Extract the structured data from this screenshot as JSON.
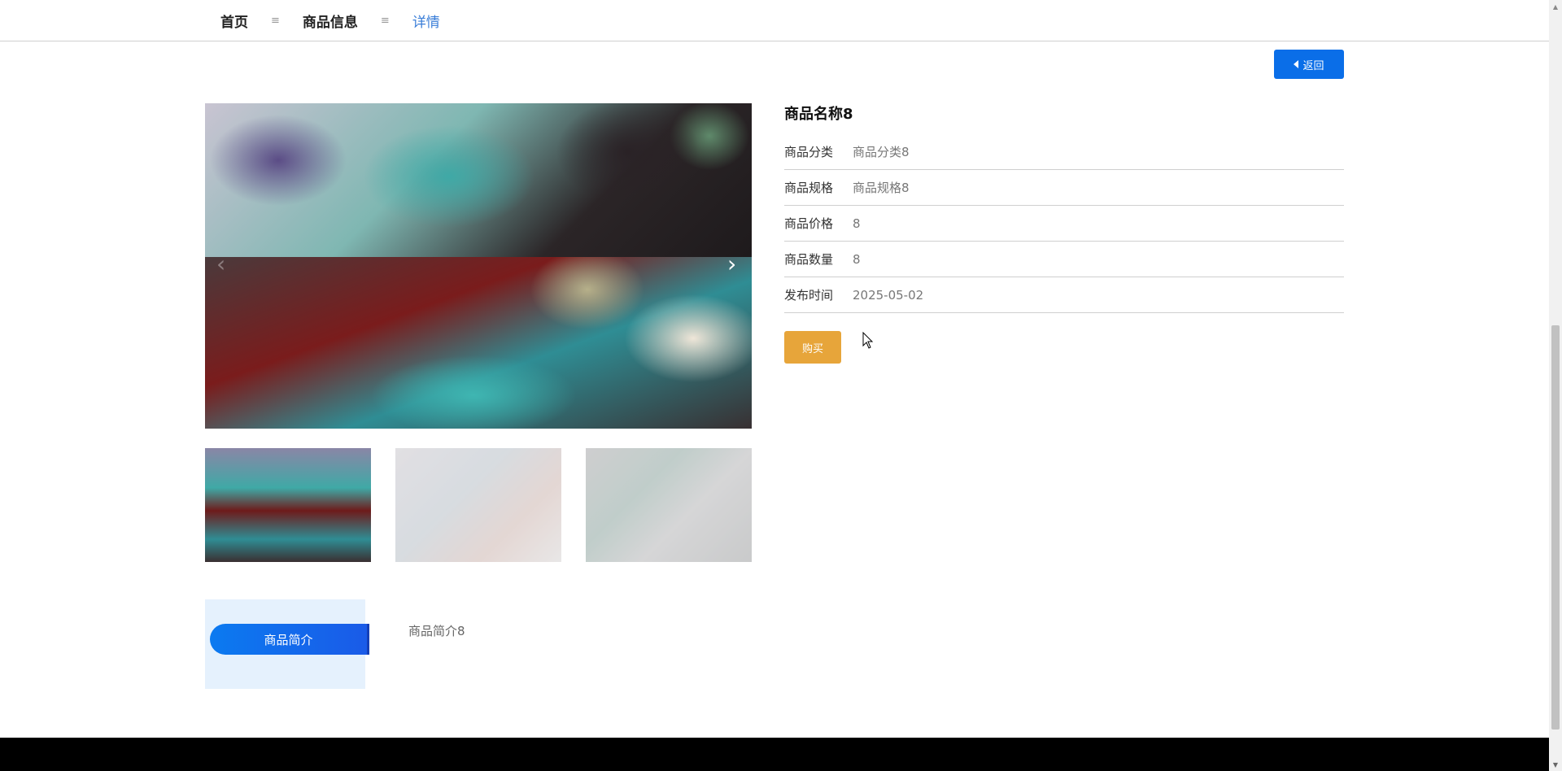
{
  "breadcrumb": {
    "home": "首页",
    "category": "商品信息",
    "current": "详情",
    "separator": "≡"
  },
  "back_button": {
    "label": "返回"
  },
  "carousel": {
    "prev_arrow": "‹",
    "next_arrow": "›",
    "main_image": "jewelry-box-image",
    "thumbnails": [
      "jewelry-box-thumb-1",
      "jewelry-box-thumb-2",
      "jewelry-box-thumb-3"
    ]
  },
  "product": {
    "name": "商品名称8",
    "fields": [
      {
        "label": "商品分类",
        "value": "商品分类8"
      },
      {
        "label": "商品规格",
        "value": "商品规格8"
      },
      {
        "label": "商品价格",
        "value": "8"
      },
      {
        "label": "商品数量",
        "value": "8"
      },
      {
        "label": "发布时间",
        "value": "2025-05-02"
      }
    ],
    "buy_label": "购买"
  },
  "tabs": {
    "intro_label": "商品简介",
    "intro_content": "商品简介8"
  },
  "colors": {
    "primary": "#0a6ee8",
    "buy": "#e7a53a",
    "active_crumb": "#3a7ed8",
    "tab_bg": "#e5f1fd",
    "footer": "#000000"
  }
}
